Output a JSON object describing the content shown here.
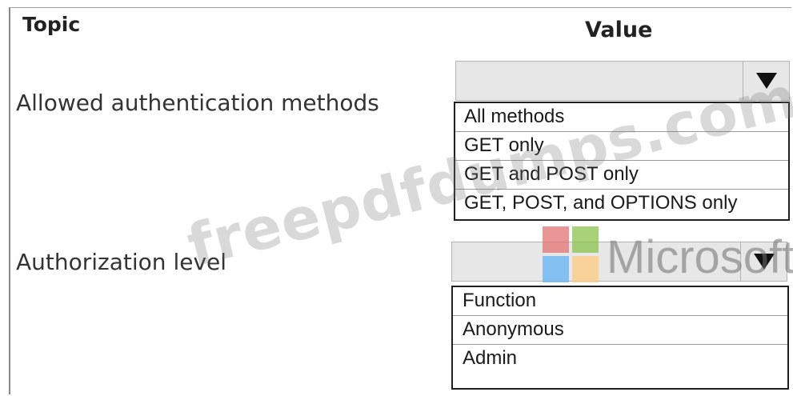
{
  "headers": {
    "topic": "Topic",
    "value": "Value"
  },
  "rows": [
    {
      "label": "Allowed authentication methods",
      "selected": "",
      "options": [
        "All methods",
        "GET only",
        "GET and POST only",
        "GET, POST, and OPTIONS only"
      ]
    },
    {
      "label": "Authorization level",
      "selected": "",
      "options": [
        "Function",
        "Anonymous",
        "Admin"
      ]
    }
  ],
  "icons": {
    "dropdown": "triangle-down-icon",
    "brand": "microsoft-logo-icon"
  },
  "watermark": {
    "site": "freepdfdumps.com",
    "brand": "Microsoft"
  },
  "colors": {
    "logo_red": "#f25022",
    "logo_green": "#7fba00",
    "logo_blue": "#00a4ef",
    "logo_yellow": "#ffb900",
    "select_bg": "#e7e7e7"
  }
}
